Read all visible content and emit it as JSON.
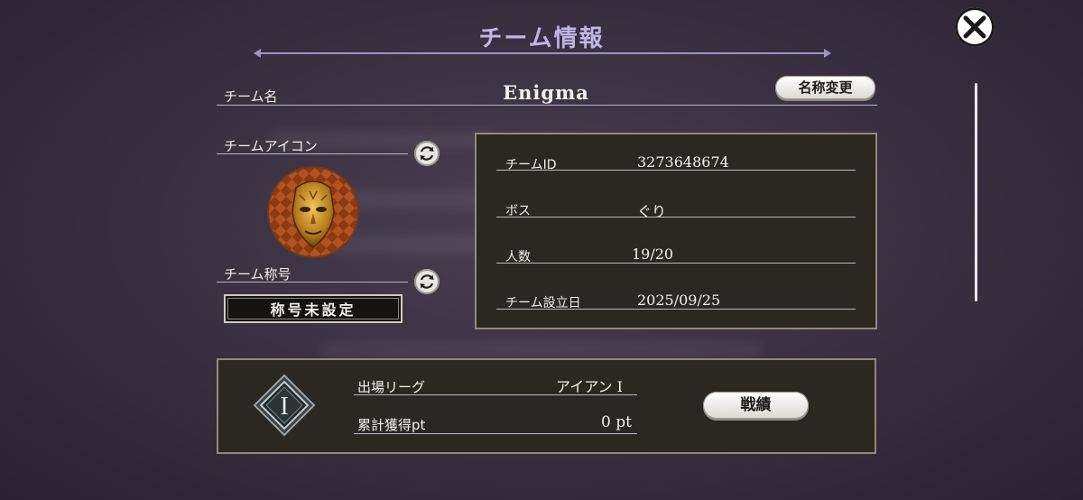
{
  "header": {
    "title": "チーム情報"
  },
  "team_name": {
    "label": "チーム名",
    "value": "Enigma",
    "rename_button": "名称変更"
  },
  "team_icon": {
    "label": "チームアイコン"
  },
  "team_title": {
    "label": "チーム称号",
    "value": "称号未設定"
  },
  "info": [
    {
      "label": "チームID",
      "value": "3273648674"
    },
    {
      "label": "ボス",
      "value": "ぐり"
    },
    {
      "label": "人数",
      "value": "19/20"
    },
    {
      "label": "チーム設立日",
      "value": "2025/09/25"
    }
  ],
  "league": {
    "rank_letter": "I",
    "league_label": "出場リーグ",
    "league_value": "アイアン I",
    "points_label": "累計獲得pt",
    "points_value": "0 pt",
    "stats_button": "戦績"
  },
  "icons": {
    "close": "close-icon",
    "refresh": "refresh-icon",
    "emblem": "stone-mask-emblem-icon",
    "rank": "rank-diamond-icon"
  }
}
